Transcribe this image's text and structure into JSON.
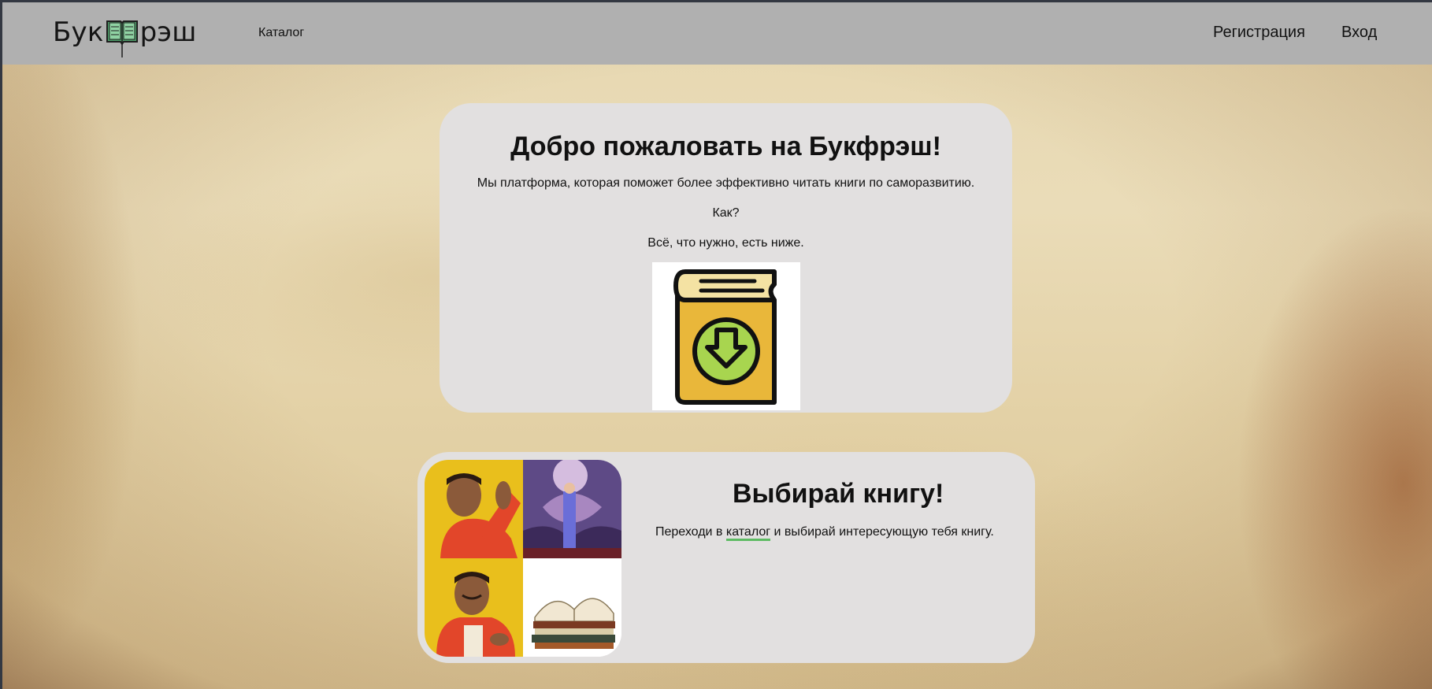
{
  "header": {
    "logo_left": "Бук",
    "logo_right": "рэш",
    "logo_icon": "open-book-icon",
    "nav": {
      "catalog": "Каталог",
      "register": "Регистрация",
      "login": "Вход"
    }
  },
  "welcome": {
    "title": "Добро пожаловать на Букфрэш!",
    "line1": "Мы платформа, которая поможет более эффективно читать книги по саморазвитию.",
    "line2": "Как?",
    "line3": "Всё, что нужно, есть ниже.",
    "image_icon": "book-download-icon"
  },
  "choose": {
    "title": "Выбирай книгу!",
    "text_before": "Переходи в ",
    "link": "каталог",
    "text_after": " и выбирай интересующую тебя книгу.",
    "image": "drake-meme-books"
  },
  "colors": {
    "header_bg": "#b0b0b0",
    "card_bg": "#e2e0e0",
    "link_underline": "#5dbb63",
    "icon_yellow": "#e9b73a",
    "icon_green": "#a8d54f"
  }
}
